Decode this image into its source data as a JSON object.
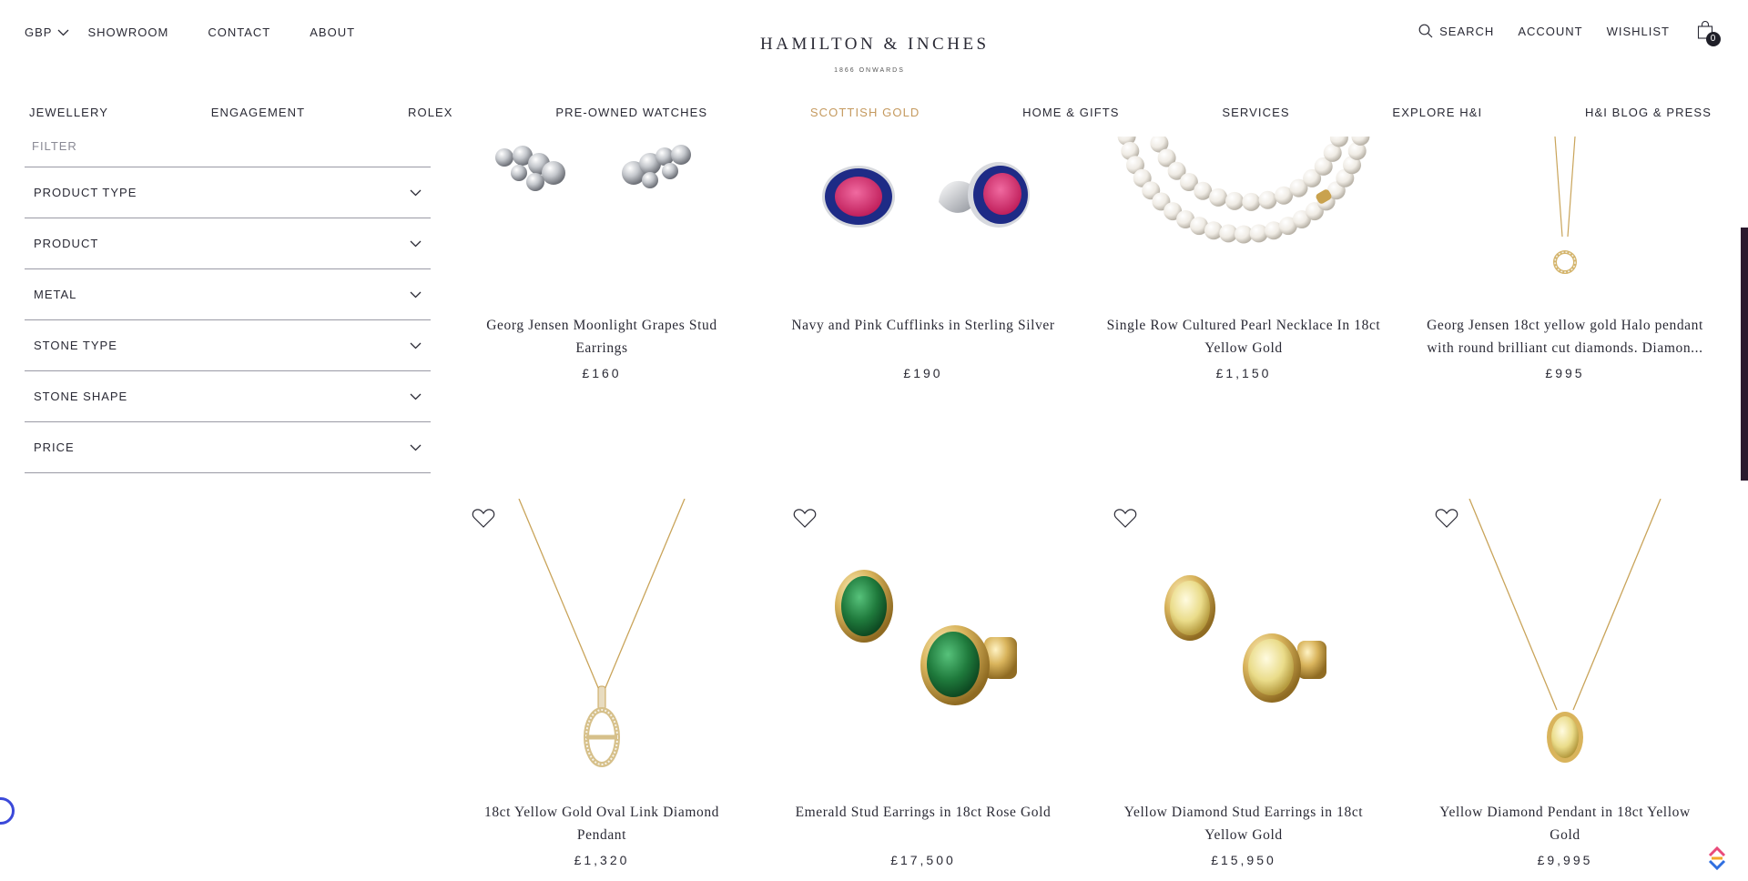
{
  "header": {
    "currency": "GBP",
    "links": [
      "SHOWROOM",
      "CONTACT",
      "ABOUT"
    ],
    "brand": "HAMILTON  &  INCHES",
    "brand_sub": "1866 ONWARDS",
    "search_label": "SEARCH",
    "account_label": "ACCOUNT",
    "wishlist_label": "WISHLIST",
    "cart_count": "0"
  },
  "nav": {
    "items": [
      "JEWELLERY",
      "ENGAGEMENT",
      "ROLEX",
      "PRE-OWNED WATCHES",
      "SCOTTISH GOLD",
      "HOME & GIFTS",
      "SERVICES",
      "EXPLORE H&I",
      "H&I BLOG & PRESS"
    ],
    "active_index": 4,
    "active_color": "#c59a5f"
  },
  "filter": {
    "label": "FILTER",
    "facets": [
      "PRODUCT TYPE",
      "PRODUCT",
      "METAL",
      "STONE TYPE",
      "STONE SHAPE",
      "PRICE"
    ]
  },
  "products": [
    {
      "title": "Georg Jensen Moonlight Grapes Stud Earrings",
      "price": "£160"
    },
    {
      "title": "Navy and Pink Cufflinks in Sterling Silver",
      "price": "£190"
    },
    {
      "title": "Single Row Cultured Pearl Necklace In 18ct Yellow Gold",
      "price": "£1,150"
    },
    {
      "title": "Georg Jensen 18ct yellow gold Halo pendant with round brilliant cut diamonds. Diamon...",
      "price": "£995"
    },
    {
      "title": "18ct Yellow Gold Oval Link Diamond Pendant",
      "price": "£1,320"
    },
    {
      "title": "Emerald Stud Earrings in 18ct Rose Gold",
      "price": "£17,500"
    },
    {
      "title": "Yellow Diamond Stud Earrings in 18ct Yellow Gold",
      "price": "£15,950"
    },
    {
      "title": "Yellow Diamond Pendant in 18ct Yellow Gold",
      "price": "£9,995"
    }
  ],
  "colors": {
    "text": "#2a2a35",
    "gold": "#c9a45a",
    "emerald": "#1f7a3c",
    "navy": "#1c2a7a",
    "pink": "#d8356f",
    "silver": "#b9bcc2",
    "pearl": "#f2efe9"
  }
}
